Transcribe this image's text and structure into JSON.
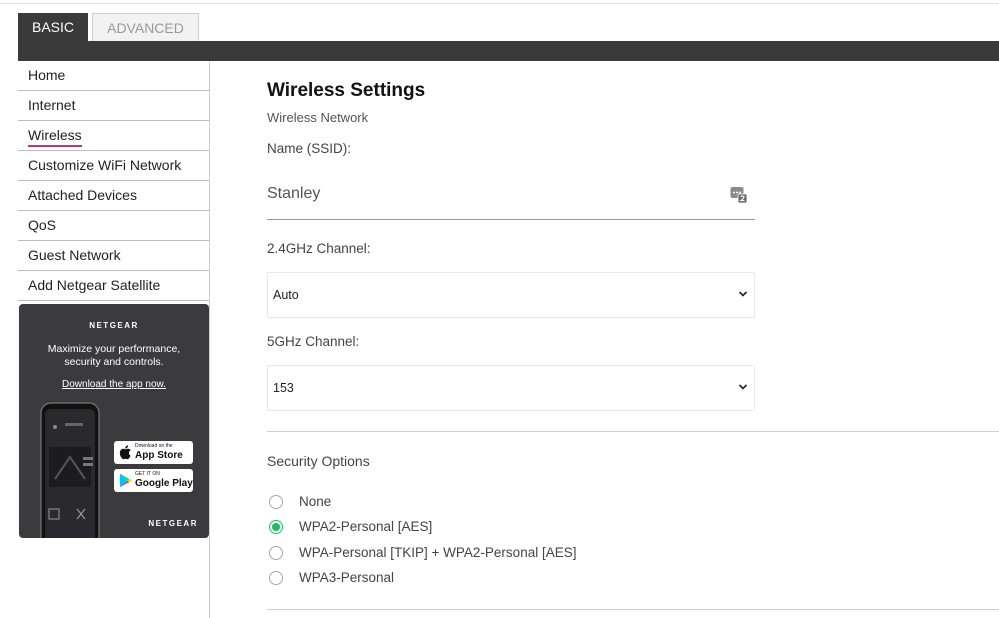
{
  "tabs": [
    {
      "label": "BASIC",
      "active": true
    },
    {
      "label": "ADVANCED",
      "active": false
    }
  ],
  "sidebar": {
    "items": [
      {
        "label": "Home"
      },
      {
        "label": "Internet"
      },
      {
        "label": "Wireless",
        "active": true
      },
      {
        "label": "Customize WiFi Network"
      },
      {
        "label": "Attached Devices"
      },
      {
        "label": "QoS"
      },
      {
        "label": "Guest Network"
      },
      {
        "label": "Add Netgear Satellite"
      }
    ],
    "promo": {
      "brand": "NETGEAR",
      "description": "Maximize your performance, security and controls.",
      "download_link": "Download the app now.",
      "app_store_small": "Download on the",
      "app_store_big": "App Store",
      "google_play_small": "GET IT ON",
      "google_play_big": "Google Play",
      "footer_brand": "NETGEAR"
    }
  },
  "main": {
    "title": "Wireless Settings",
    "section": "Wireless Network",
    "ssid_label": "Name (SSID):",
    "ssid_value": "Stanley",
    "channel_24_label": "2.4GHz Channel:",
    "channel_24_value": "Auto",
    "channel_5_label": "5GHz Channel:",
    "channel_5_value": "153",
    "security_title": "Security Options",
    "security_options": [
      {
        "label": "None",
        "selected": false
      },
      {
        "label": "WPA2-Personal [AES]",
        "selected": true
      },
      {
        "label": "WPA-Personal [TKIP] + WPA2-Personal [AES]",
        "selected": false
      },
      {
        "label": "WPA3-Personal",
        "selected": false
      }
    ]
  },
  "colors": {
    "header_dark": "#3a3a3a",
    "active_underline": "#b03a88",
    "radio_selected": "#1bbf5f",
    "promo_bg": "#3b3b3d"
  }
}
